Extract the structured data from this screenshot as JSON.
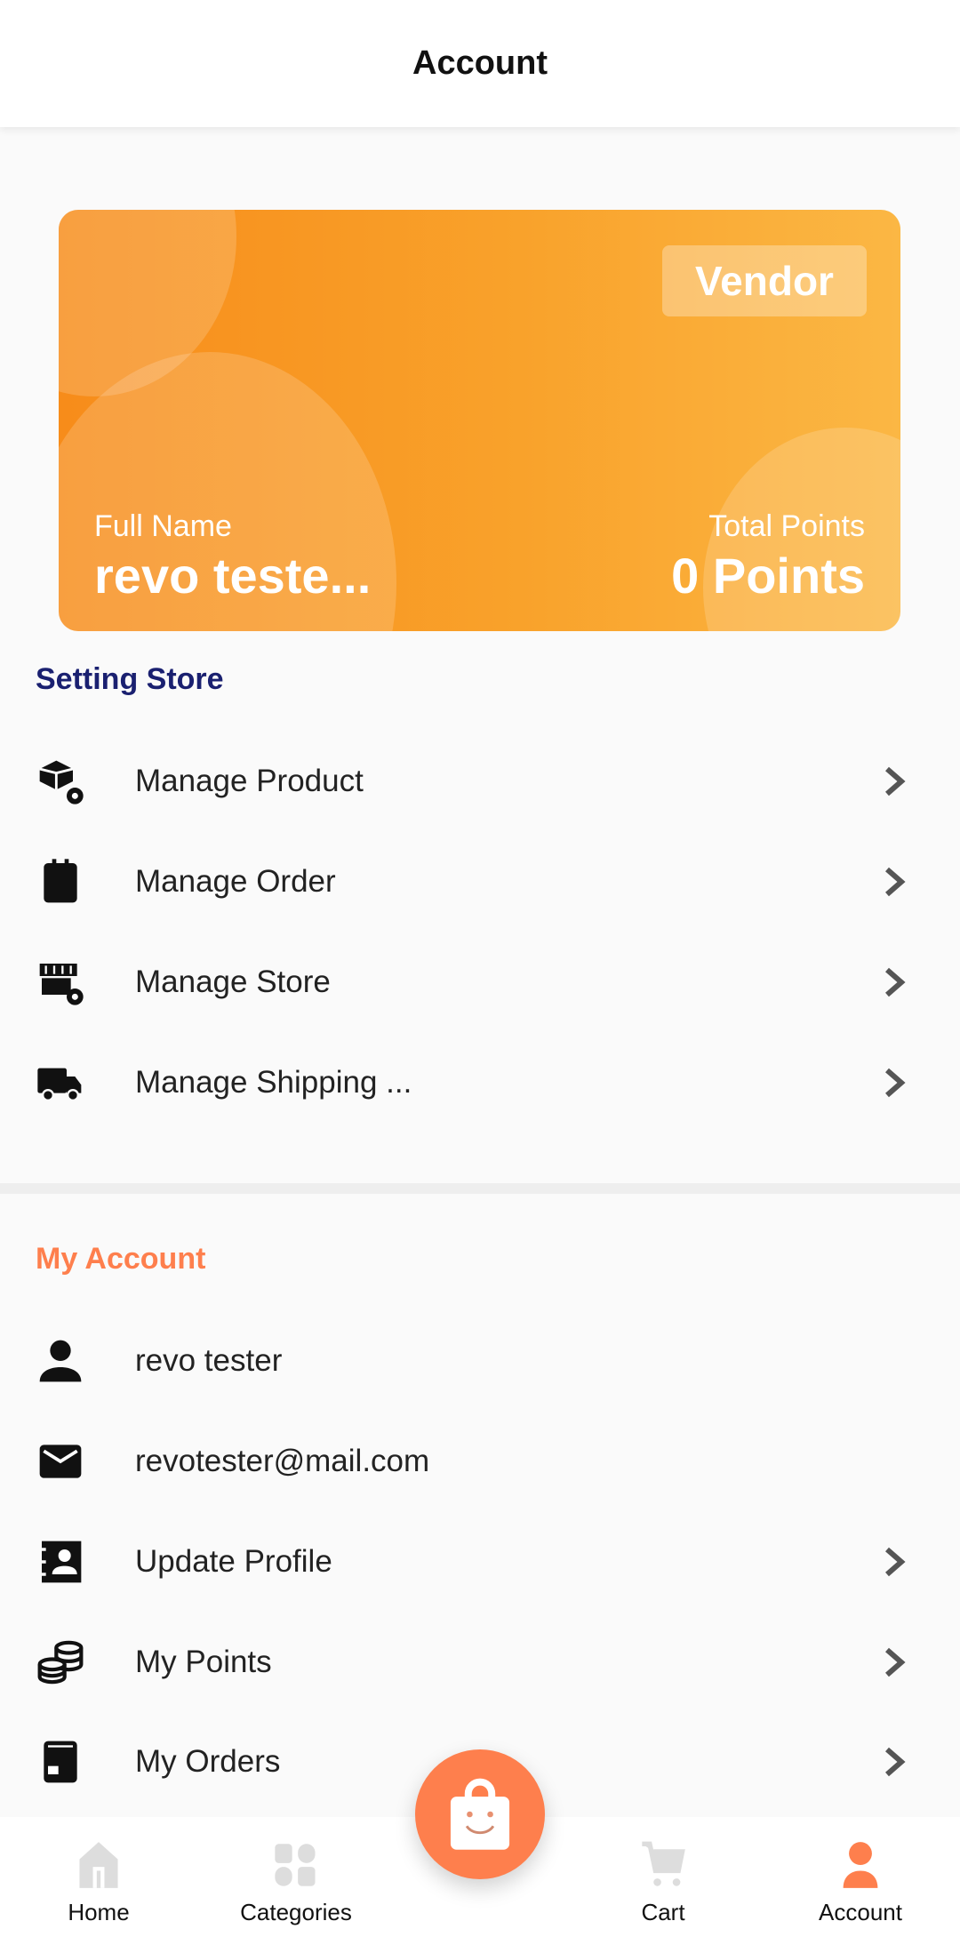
{
  "header": {
    "title": "Account"
  },
  "card": {
    "badge": "Vendor",
    "name_label": "Full Name",
    "name_value": "revo teste...",
    "points_label": "Total Points",
    "points_value": "0 Points"
  },
  "setting_store": {
    "title": "Setting Store",
    "title_color": "#1a2070",
    "items": [
      {
        "label": "Manage Product",
        "icon": "box-gear-icon"
      },
      {
        "label": "Manage Order",
        "icon": "clipboard-icon"
      },
      {
        "label": "Manage Store",
        "icon": "store-gear-icon"
      },
      {
        "label": "Manage Shipping ...",
        "icon": "truck-icon"
      }
    ]
  },
  "my_account": {
    "title": "My Account",
    "title_color": "#fe7f4d",
    "items": [
      {
        "label": "revo tester",
        "icon": "person-icon"
      },
      {
        "label": "revotester@mail.com",
        "icon": "email-icon"
      },
      {
        "label": "Update Profile",
        "icon": "contact-card-icon"
      },
      {
        "label": "My Points",
        "icon": "coins-icon"
      },
      {
        "label": "My Orders",
        "icon": "orders-icon"
      }
    ]
  },
  "nav": {
    "items": [
      {
        "label": "Home"
      },
      {
        "label": "Categories"
      },
      {
        "label": "Cart"
      },
      {
        "label": "Account"
      }
    ],
    "active": "Account",
    "accent": "#fe7f4d"
  }
}
